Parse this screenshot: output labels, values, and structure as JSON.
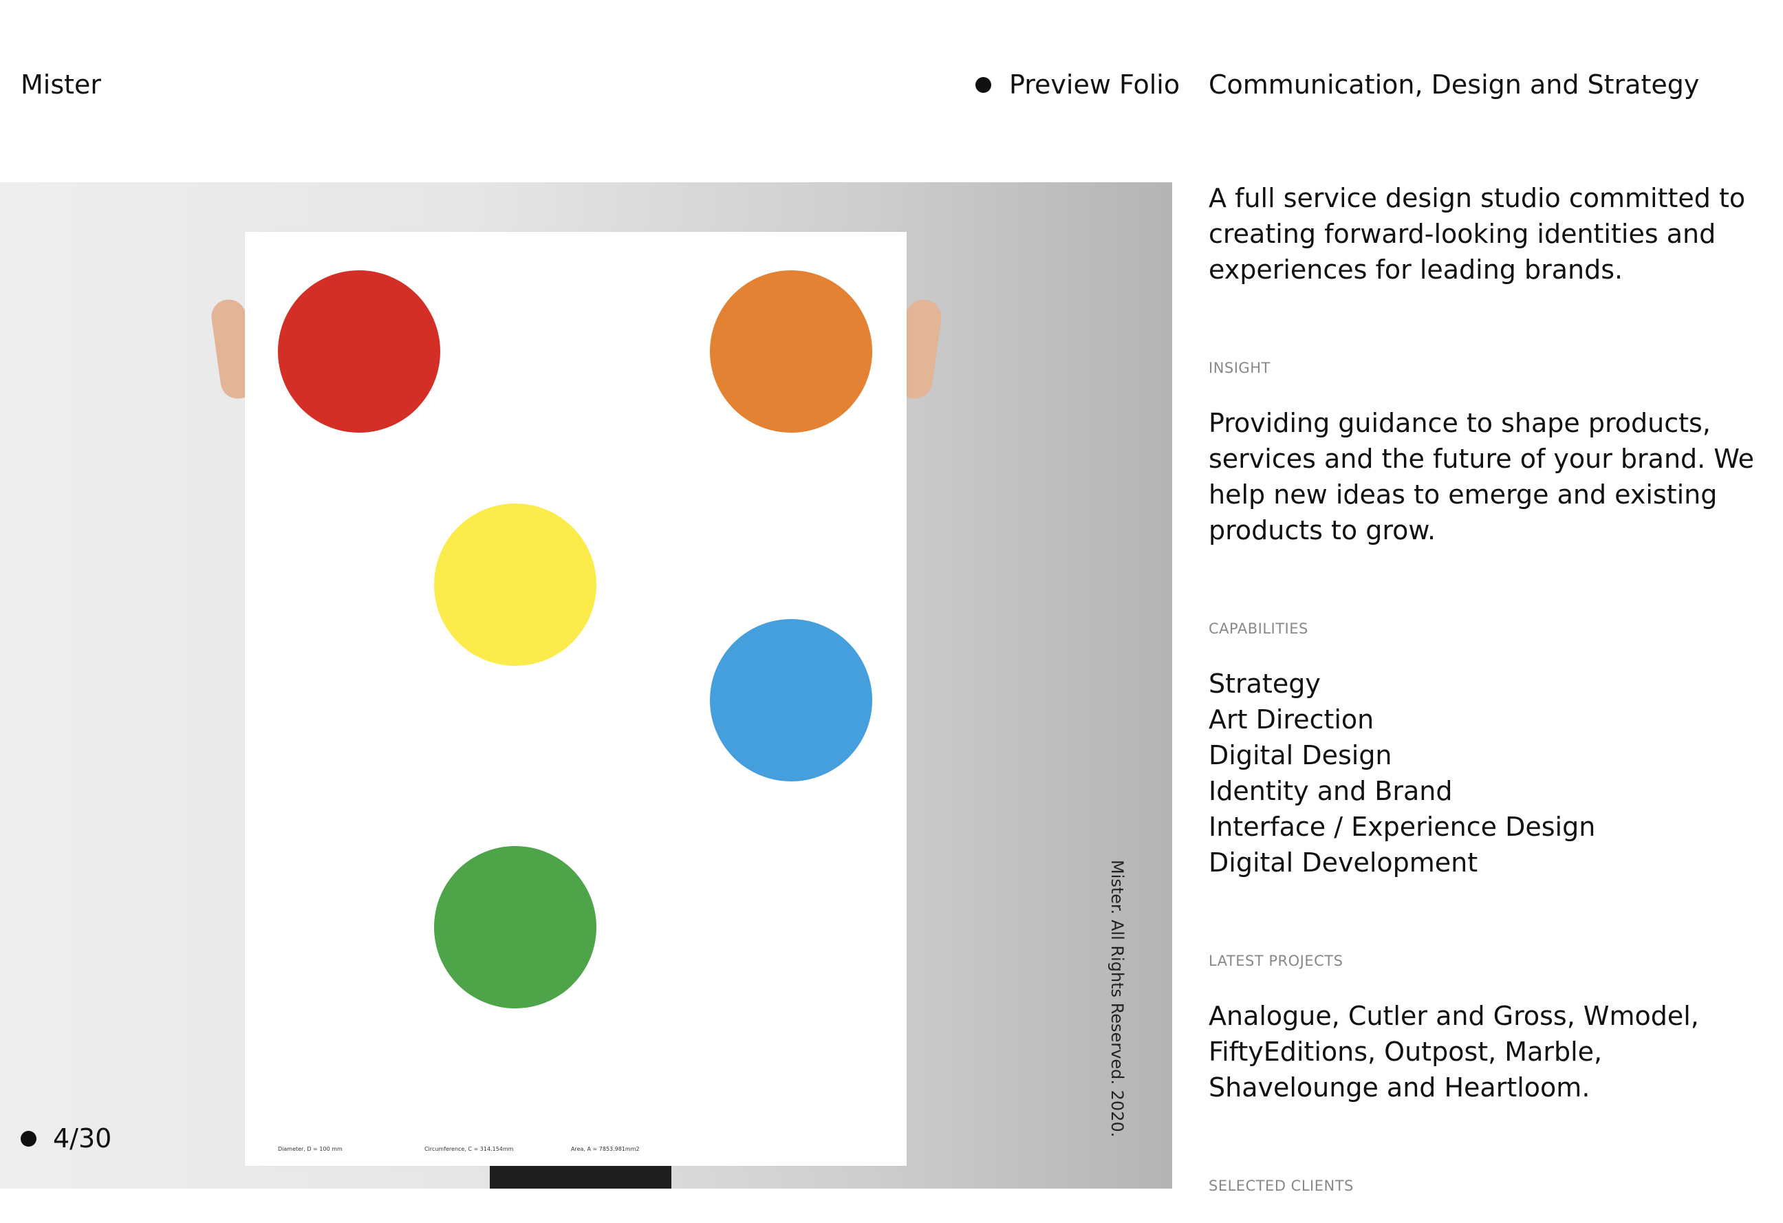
{
  "header": {
    "logo": "Mister",
    "preview_link": "Preview Folio",
    "tagline": "Communication, Design and Strategy"
  },
  "hero": {
    "counter": "4/30",
    "copyright": "Mister. All Rights Reserved. 2020.",
    "poster": {
      "circles": [
        {
          "name": "red",
          "color": "#d32f27"
        },
        {
          "name": "orange",
          "color": "#e38232"
        },
        {
          "name": "yellow",
          "color": "#fbec4c"
        },
        {
          "name": "blue",
          "color": "#459fdd"
        },
        {
          "name": "green",
          "color": "#4ea449"
        }
      ],
      "notes": [
        "Diameter, D = 100 mm",
        "Circumference, C = 314.154mm",
        "Area, A = 7853.981mm2"
      ]
    }
  },
  "sidebar": {
    "intro": "A full service design studio committed to creating forward-looking identities and experiences for leading brands.",
    "insight": {
      "label": "INSIGHT",
      "text": "Providing guidance to shape products, services and the future of your brand. We help new ideas to emerge and existing products to grow."
    },
    "capabilities": {
      "label": "CAPABILITIES",
      "items": [
        "Strategy",
        "Art Direction",
        "Digital Design",
        "Identity and Brand",
        "Interface / Experience Design",
        "Digital Development"
      ]
    },
    "latest_projects": {
      "label": "LATEST PROJECTS",
      "text": "Analogue, Cutler and Gross, Wmodel, FiftyEditions, Outpost, Marble, Shavelounge and Heartloom."
    },
    "selected_clients": {
      "label": "SELECTED CLIENTS"
    }
  }
}
